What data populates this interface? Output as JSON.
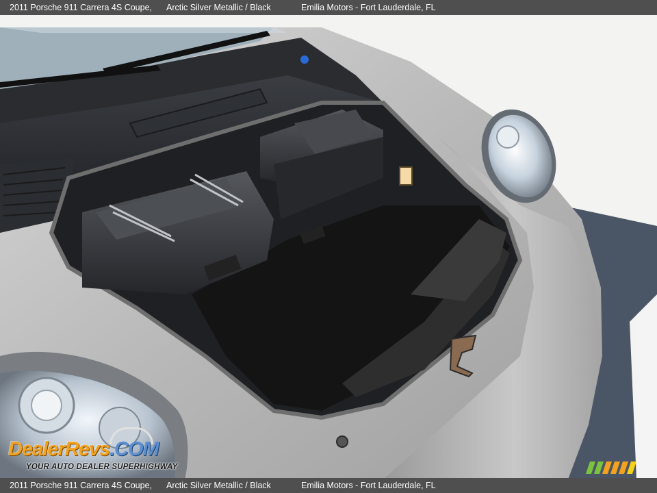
{
  "header": {
    "vehicle": "2011 Porsche 911 Carrera 4S Coupe,",
    "color": "Arctic Silver Metallic / Black",
    "dealer": "Emilia Motors - Fort Lauderdale, FL"
  },
  "footer": {
    "vehicle": "2011 Porsche 911 Carrera 4S Coupe,",
    "color": "Arctic Silver Metallic / Black",
    "dealer": "Emilia Motors - Fort Lauderdale, FL"
  },
  "watermark": {
    "brand_part1": "DealerRevs",
    "brand_part2": ".COM",
    "tagline": "YOUR AUTO DEALER SUPERHIGHWAY"
  },
  "photo": {
    "subject": "front-trunk",
    "colors": {
      "paint": "#bdbdbd",
      "trunk_lining": "#1c1c1c",
      "asphalt": "#4a5566"
    }
  }
}
